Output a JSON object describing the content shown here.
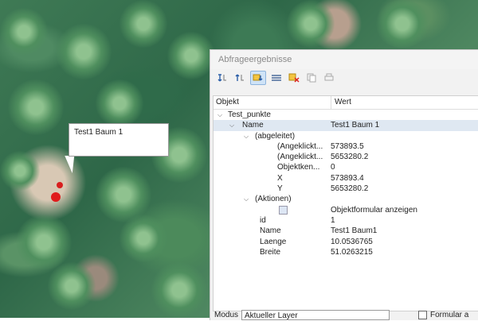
{
  "map": {
    "callout_text": "Test1 Baum 1"
  },
  "panel": {
    "title": "Abfrageergebnisse",
    "toolbar_icons": [
      "expand-icon",
      "collapse-icon",
      "expand-new-icon",
      "deselect-icon",
      "clear-icon",
      "copy-icon",
      "print-icon"
    ],
    "columns": {
      "object": "Objekt",
      "value": "Wert"
    },
    "layer": "Test_punkte",
    "name_row": {
      "key": "Name",
      "value": "Test1 Baum 1"
    },
    "derived": {
      "label": "(abgeleitet)",
      "rows": [
        {
          "key": "(Angeklickt...",
          "value": "573893.5"
        },
        {
          "key": "(Angeklickt...",
          "value": "5653280.2"
        },
        {
          "key": "Objektken...",
          "value": "0"
        },
        {
          "key": "X",
          "value": "573893.4"
        },
        {
          "key": "Y",
          "value": "5653280.2"
        }
      ]
    },
    "actions": {
      "label": "(Aktionen)",
      "action_text": "Objektformular anzeigen"
    },
    "attributes": [
      {
        "key": "id",
        "value": "1"
      },
      {
        "key": "Name",
        "value": "Test1 Baum1"
      },
      {
        "key": "Laenge",
        "value": "10.0536765"
      },
      {
        "key": "Breite",
        "value": "51.0263215"
      }
    ],
    "footer": {
      "mode_label": "Modus",
      "mode_value": "Aktueller Layer",
      "checkbox_label": "Formular a"
    }
  }
}
